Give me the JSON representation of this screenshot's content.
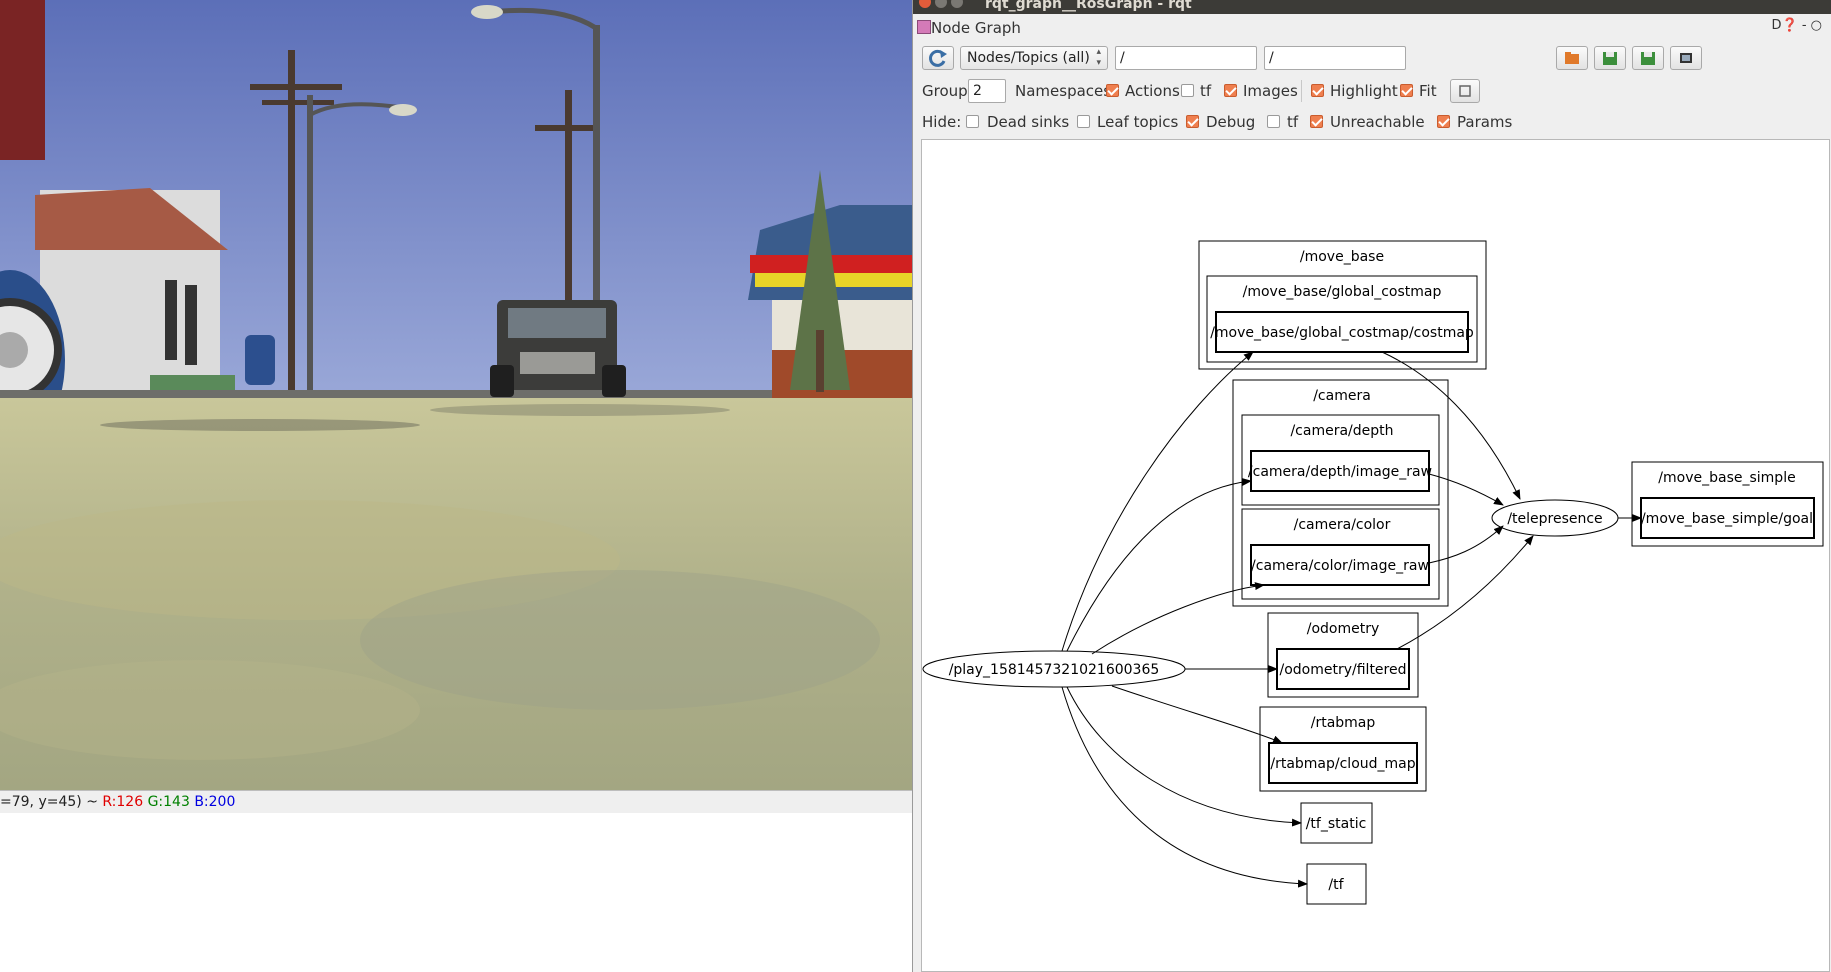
{
  "status_bar": {
    "coords": "=79, y=45) ~ ",
    "r": "R:126",
    "g": "G:143",
    "b": "B:200",
    "colors": {
      "r": "#e00000",
      "g": "#008000",
      "b": "#0000e0"
    }
  },
  "window": {
    "title": "rqt_graph__RosGraph - rqt"
  },
  "plugin": {
    "title": "Node Graph",
    "controls": "D❓ -  ○"
  },
  "toolbar": {
    "refresh_icon": "refresh-icon",
    "mode_selected": "Nodes/Topics (all)",
    "node_filter": "/",
    "topic_filter": "/",
    "right_icons": [
      "load-dot-icon",
      "save-dot-icon",
      "save-svg-icon",
      "save-image-icon"
    ]
  },
  "group_row": {
    "group_label": "Group:",
    "group_value": "2",
    "namespaces_label": "Namespaces",
    "actions": {
      "label": "Actions",
      "checked": true
    },
    "tf": {
      "label": "tf",
      "checked": false
    },
    "images": {
      "label": "Images",
      "checked": true
    },
    "highlight": {
      "label": "Highlight",
      "checked": true
    },
    "fit": {
      "label": "Fit",
      "checked": true
    },
    "fit_button_icon": "fit-view-icon"
  },
  "hide_row": {
    "hide_label": "Hide:",
    "dead_sinks": {
      "label": "Dead sinks",
      "checked": false
    },
    "leaf_topics": {
      "label": "Leaf topics",
      "checked": false
    },
    "debug": {
      "label": "Debug",
      "checked": true
    },
    "tf": {
      "label": "tf",
      "checked": false
    },
    "unreachable": {
      "label": "Unreachable",
      "checked": true
    },
    "params": {
      "label": "Params",
      "checked": true
    }
  },
  "graph": {
    "clusters": {
      "move_base": "/move_base",
      "global_costmap": "/move_base/global_costmap",
      "camera": "/camera",
      "camera_depth": "/camera/depth",
      "camera_color": "/camera/color",
      "odometry": "/odometry",
      "rtabmap": "/rtabmap",
      "move_base_simple": "/move_base_simple"
    },
    "topics": {
      "costmap": "/move_base/global_costmap/costmap",
      "depth_image": "/camera/depth/image_raw",
      "color_image": "/camera/color/image_raw",
      "odom_filtered": "/odometry/filtered",
      "cloud_map": "/rtabmap/cloud_map",
      "tf_static": "/tf_static",
      "tf": "/tf",
      "goal": "/move_base_simple/goal"
    },
    "nodes": {
      "play": "/play_1581457321021600365",
      "telepresence": "/telepresence"
    }
  },
  "colors": {
    "accent_checkbox": "#ef7f4f",
    "titlebar": "#3c3b37",
    "sky": "#7183c4",
    "ground": "#a6a47a"
  }
}
